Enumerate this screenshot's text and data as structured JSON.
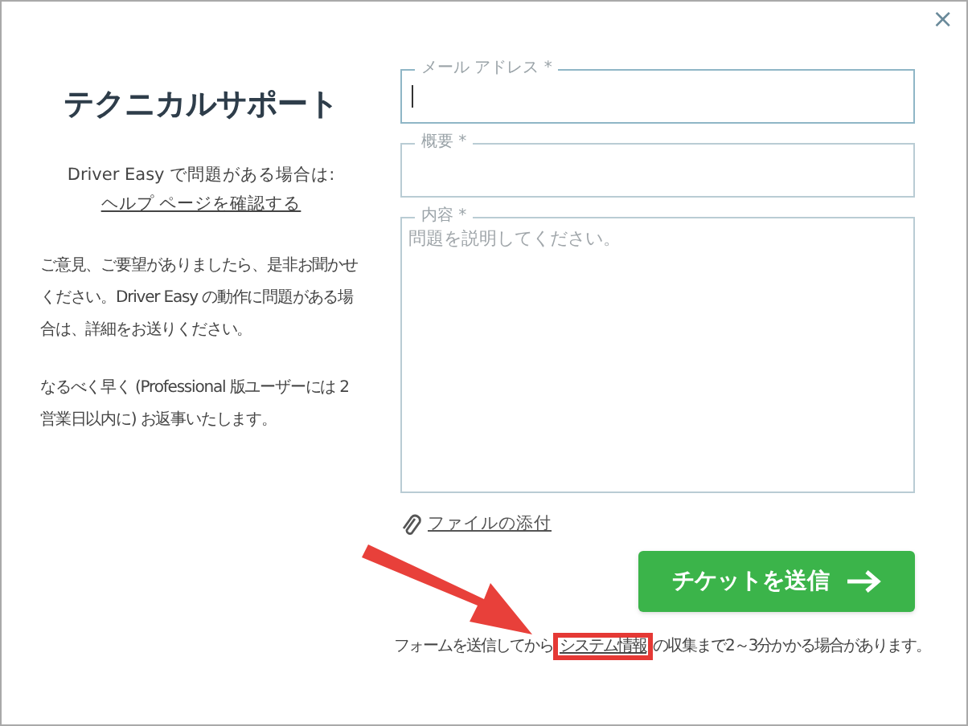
{
  "close": "×",
  "sidebar": {
    "title": "テクニカルサポート",
    "help_intro": "Driver Easy で問題がある場合は:",
    "help_link": "ヘルプ ページを確認する",
    "paragraphs": [
      "ご意見、ご要望がありましたら、是非お聞かせください。Driver Easy の動作に問題がある場合は、詳細をお送りください。",
      "なるべく早く (Professional 版ユーザーには 2 営業日以内に) お返事いたします。"
    ]
  },
  "form": {
    "fields": [
      {
        "kind": "line",
        "label": "メール アドレス *",
        "focused": true
      },
      {
        "kind": "line",
        "label": "概要 *",
        "focused": false
      },
      {
        "kind": "area",
        "label": "内容 *",
        "placeholder": "問題を説明してください。",
        "focused": false
      }
    ],
    "attach": "ファイルの添付",
    "submit": "チケットを送信",
    "note": {
      "before": "フォームを送信してから",
      "link": "システム情報",
      "after": "の収集まで2～3分かかる場合があります。"
    }
  }
}
